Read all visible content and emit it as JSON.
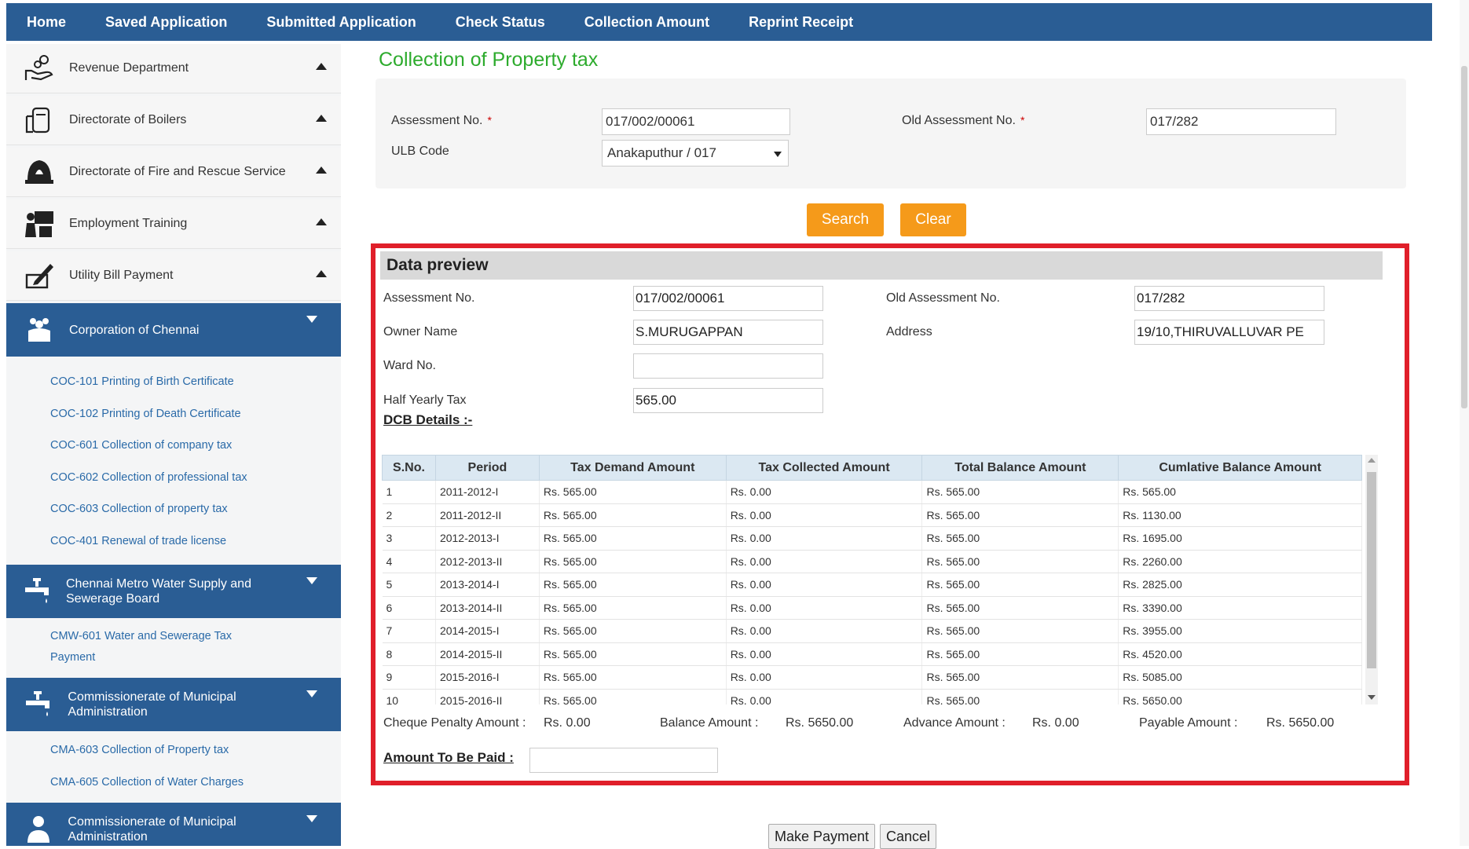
{
  "nav": [
    "Home",
    "Saved Application",
    "Submitted Application",
    "Check Status",
    "Collection Amount",
    "Reprint Receipt"
  ],
  "sidebar": {
    "items": [
      {
        "label": "Revenue Department",
        "icon": "hand-coins-icon"
      },
      {
        "label": "Directorate of Boilers",
        "icon": "boiler-icon"
      },
      {
        "label": "Directorate of Fire and Rescue Service",
        "icon": "fire-helmet-icon"
      },
      {
        "label": "Employment Training",
        "icon": "training-icon"
      },
      {
        "label": "Utility Bill Payment",
        "icon": "bill-payment-icon"
      }
    ],
    "corp_chennai": {
      "label": "Corporation of Chennai",
      "subs": [
        "COC-101 Printing of Birth Certificate",
        "COC-102 Printing of Death Certificate",
        "COC-601 Collection of company tax",
        "COC-602 Collection of professional tax",
        "COC-603 Collection of property tax",
        "COC-401 Renewal of trade license"
      ]
    },
    "metro_water": {
      "label": "Chennai Metro Water Supply and Sewerage Board",
      "subs": [
        "CMW-601 Water and Sewerage Tax Payment"
      ]
    },
    "municipal_1": {
      "label": "Commissionerate of Municipal Administration",
      "subs": [
        "CMA-603 Collection of Property tax",
        "CMA-605 Collection of Water Charges"
      ]
    },
    "municipal_2": {
      "label": "Commissionerate of Municipal Administration"
    }
  },
  "form": {
    "title": "Collection of Property tax",
    "assessment_label": "Assessment No.",
    "assessment_value": "017/002/00061",
    "old_assessment_label": "Old Assessment No.",
    "old_assessment_value": "017/282",
    "ulb_label": "ULB Code",
    "ulb_value": "Anakaputhur / 017",
    "required_mark": "*",
    "search_label": "Search",
    "clear_label": "Clear"
  },
  "preview": {
    "title": "Data preview",
    "assessment_label": "Assessment No.",
    "assessment_value": "017/002/00061",
    "old_assessment_label": "Old Assessment No.",
    "old_assessment_value": "017/282",
    "owner_label": "Owner Name",
    "owner_value": "S.MURUGAPPAN",
    "address_label": "Address",
    "address_value": "19/10,THIRUVALLUVAR PE",
    "ward_label": "Ward No.",
    "ward_value": "",
    "half_yearly_label": "Half Yearly Tax",
    "half_yearly_value": "565.00",
    "dcb_label": "DCB Details :-",
    "table": {
      "headers": [
        "S.No.",
        "Period",
        "Tax Demand Amount",
        "Tax Collected Amount",
        "Total Balance Amount",
        "Cumlative Balance Amount"
      ],
      "rows": [
        [
          "1",
          "2011-2012-I",
          "Rs. 565.00",
          "Rs. 0.00",
          "Rs. 565.00",
          "Rs. 565.00"
        ],
        [
          "2",
          "2011-2012-II",
          "Rs. 565.00",
          "Rs. 0.00",
          "Rs. 565.00",
          "Rs. 1130.00"
        ],
        [
          "3",
          "2012-2013-I",
          "Rs. 565.00",
          "Rs. 0.00",
          "Rs. 565.00",
          "Rs. 1695.00"
        ],
        [
          "4",
          "2012-2013-II",
          "Rs. 565.00",
          "Rs. 0.00",
          "Rs. 565.00",
          "Rs. 2260.00"
        ],
        [
          "5",
          "2013-2014-I",
          "Rs. 565.00",
          "Rs. 0.00",
          "Rs. 565.00",
          "Rs. 2825.00"
        ],
        [
          "6",
          "2013-2014-II",
          "Rs. 565.00",
          "Rs. 0.00",
          "Rs. 565.00",
          "Rs. 3390.00"
        ],
        [
          "7",
          "2014-2015-I",
          "Rs. 565.00",
          "Rs. 0.00",
          "Rs. 565.00",
          "Rs. 3955.00"
        ],
        [
          "8",
          "2014-2015-II",
          "Rs. 565.00",
          "Rs. 0.00",
          "Rs. 565.00",
          "Rs. 4520.00"
        ],
        [
          "9",
          "2015-2016-I",
          "Rs. 565.00",
          "Rs. 0.00",
          "Rs. 565.00",
          "Rs. 5085.00"
        ],
        [
          "10",
          "2015-2016-II",
          "Rs. 565.00",
          "Rs. 0.00",
          "Rs. 565.00",
          "Rs. 5650.00"
        ]
      ]
    },
    "summary": {
      "cheque_penalty_label": "Cheque Penalty Amount :",
      "cheque_penalty_value": "Rs. 0.00",
      "balance_label": "Balance Amount :",
      "balance_value": "Rs. 5650.00",
      "advance_label": "Advance Amount :",
      "advance_value": "Rs. 0.00",
      "payable_label": "Payable Amount :",
      "payable_value": "Rs. 5650.00"
    },
    "amount_label": "Amount To Be Paid :",
    "amount_value": ""
  },
  "actions": {
    "make_payment": "Make Payment",
    "cancel": "Cancel"
  },
  "colors": {
    "nav_bg": "#2a5d94",
    "title_green": "#2dab2d",
    "orange": "#f59a1a",
    "highlight_red": "#e01f2a",
    "link_blue": "#2a6aa8"
  }
}
